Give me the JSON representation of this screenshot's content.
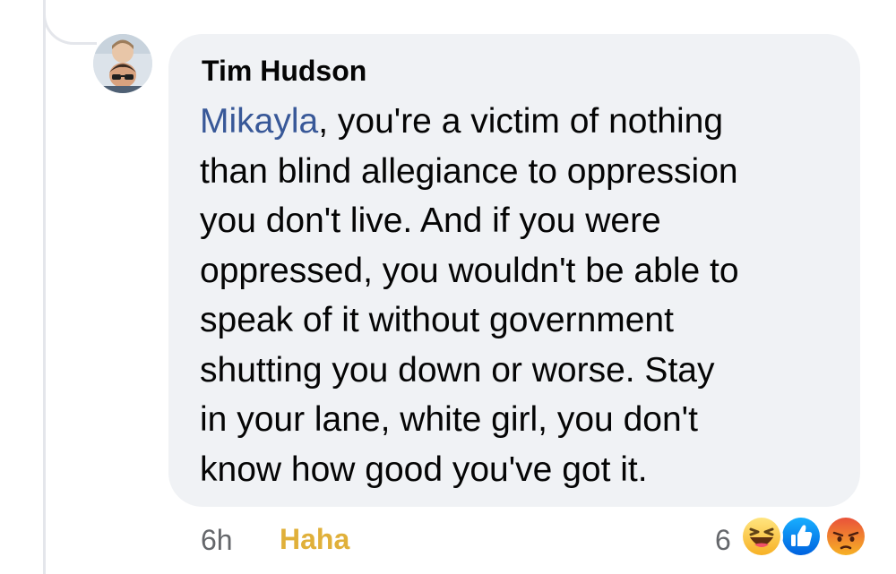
{
  "comment": {
    "author": "Tim Hudson",
    "mention": "Mikayla",
    "text_lines": [
      ", you're a victim of nothing",
      "than blind allegiance to oppression",
      "you don't live. And if you were",
      "oppressed, you wouldn't be able to",
      "speak of it without government",
      "shutting you down or worse. Stay",
      "in your lane, white girl, you don't",
      "know how good you've got it."
    ],
    "time": "6h",
    "reaction_label": "Haha",
    "reaction_count": "6",
    "reaction_icons": [
      "haha-emoji",
      "like-emoji",
      "angry-emoji"
    ]
  },
  "colors": {
    "bubble_background": "#f0f2f5",
    "mention": "#385898",
    "haha_label": "#e0b03a",
    "meta_text": "#65676b"
  }
}
